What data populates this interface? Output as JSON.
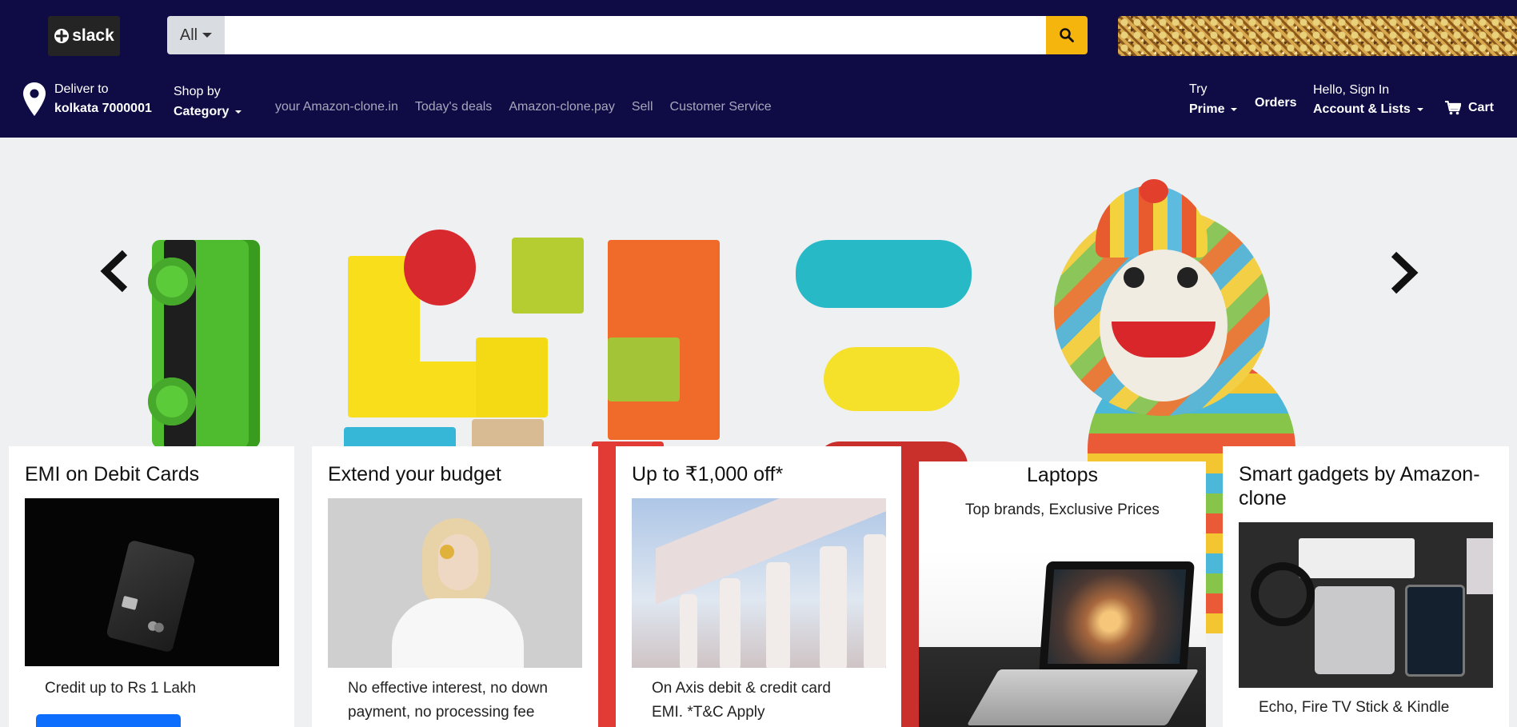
{
  "header": {
    "logo_text": "slack",
    "search": {
      "category": "All",
      "value": "",
      "placeholder": ""
    },
    "deliver": {
      "label": "Deliver to",
      "location": "kolkata 7000001"
    },
    "shop_by": {
      "label": "Shop by",
      "value": "Category"
    },
    "nav_links": [
      "your Amazon-clone.in",
      "Today's deals",
      "Amazon-clone.pay",
      "Sell",
      "Customer Service"
    ],
    "prime": {
      "label": "Try",
      "value": "Prime"
    },
    "orders": "Orders",
    "account": {
      "label": "Hello, Sign In",
      "value": "Account & Lists"
    },
    "cart": "Cart"
  },
  "cards": [
    {
      "title": "EMI on Debit Cards",
      "caption": "Credit up to Rs 1 Lakh"
    },
    {
      "title": "Extend your budget",
      "caption_line1": "No effective interest, no down",
      "caption_line2": "payment, no processing fee"
    },
    {
      "title": "Up to ₹1,000 off*",
      "caption_line1": "On Axis debit & credit card",
      "caption_line2": "EMI. *T&C Apply"
    },
    {
      "title": "Laptops",
      "subtitle": "Top brands, Exclusive Prices"
    },
    {
      "title_line1": "Smart gadgets by Amazon-",
      "title_line2": "clone",
      "caption": "Echo, Fire TV Stick & Kindle"
    }
  ],
  "icons": {
    "logo": "slack-logo-icon",
    "search": "search-icon",
    "location": "map-pin-icon",
    "cart": "shopping-cart-icon",
    "prev": "chevron-left-icon",
    "next": "chevron-right-icon"
  },
  "colors": {
    "header_bg": "#0f0c45",
    "search_button": "#f5b50c",
    "nav_link": "#a7a7bb",
    "primary_button": "#0d6efd"
  }
}
